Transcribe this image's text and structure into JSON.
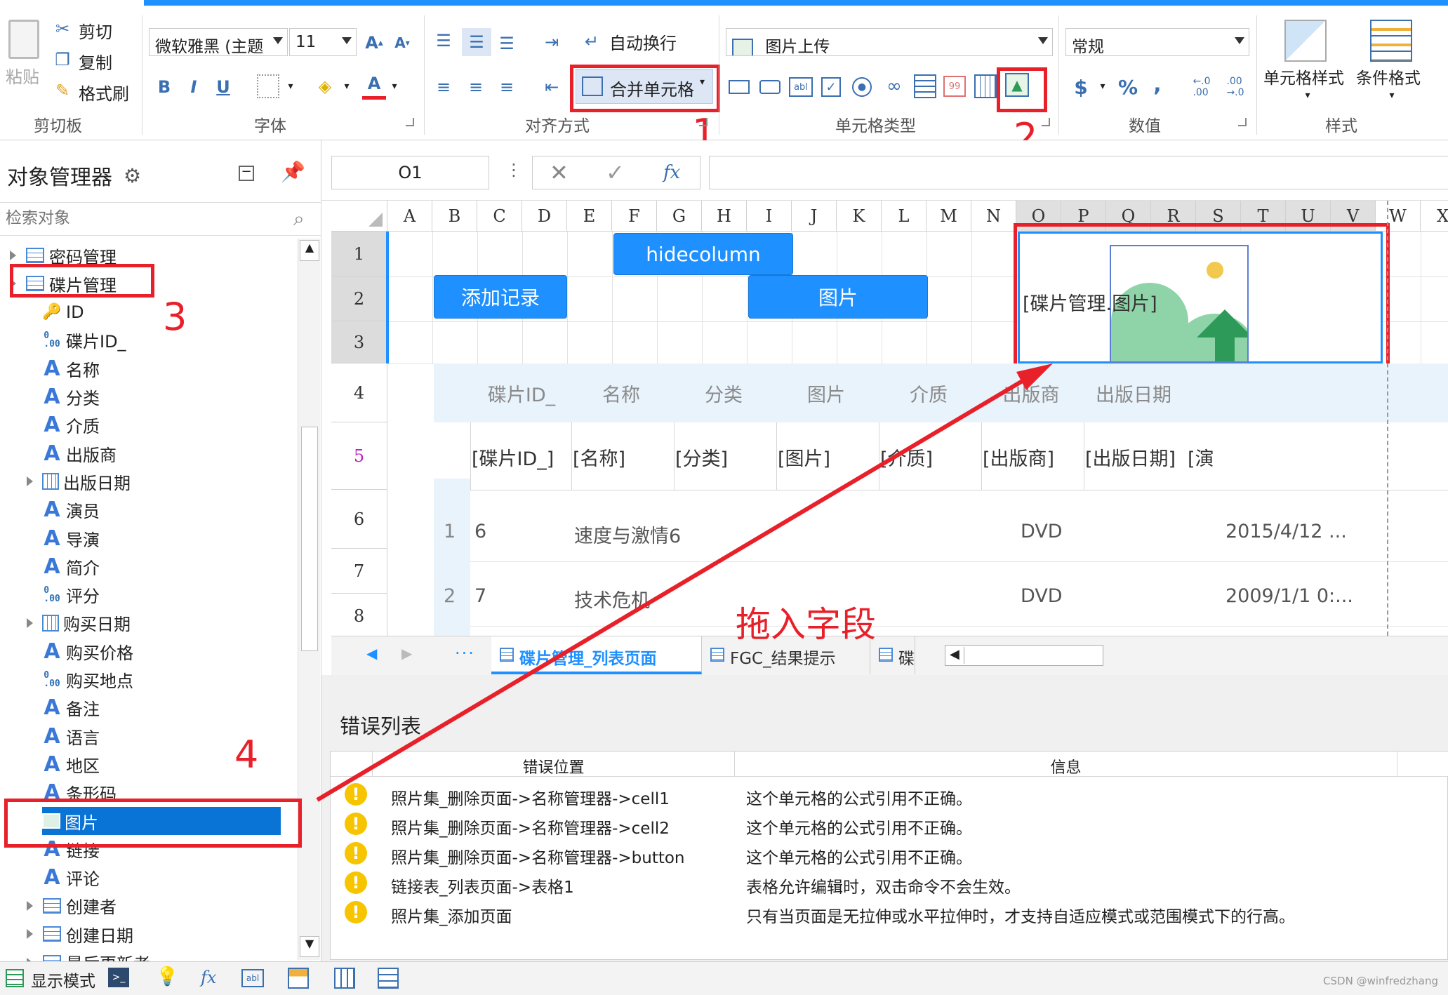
{
  "ribbon": {
    "clipboard": {
      "paste_label": "粘贴",
      "cut_label": "剪切",
      "copy_label": "复制",
      "format_painter_label": "格式刷",
      "group_label": "剪切板"
    },
    "font": {
      "font_name": "微软雅黑 (主题",
      "font_size": "11",
      "bold": "B",
      "italic": "I",
      "underline": "U",
      "group_label": "字体"
    },
    "alignment": {
      "wrap_text_label": "自动换行",
      "merge_cells_label": "合并单元格",
      "group_label": "对齐方式"
    },
    "cell_type": {
      "selected_type": "图片上传",
      "group_label": "单元格类型"
    },
    "number": {
      "format": "常规",
      "currency": "$",
      "percent": "%",
      "comma": ",",
      "group_label": "数值"
    },
    "styles": {
      "cell_style_label": "单元格样式",
      "conditional_format_label": "条件格式",
      "group_label": "样式"
    }
  },
  "object_manager": {
    "title": "对象管理器",
    "search_placeholder": "检索对象",
    "items": [
      {
        "label": "密码管理",
        "type": "table",
        "indent": 0,
        "expandable": true
      },
      {
        "label": "碟片管理",
        "type": "table",
        "indent": 0,
        "expandable": true
      },
      {
        "label": "ID",
        "type": "key",
        "indent": 1
      },
      {
        "label": "碟片ID_",
        "type": "number",
        "indent": 1
      },
      {
        "label": "名称",
        "type": "text",
        "indent": 1
      },
      {
        "label": "分类",
        "type": "text",
        "indent": 1
      },
      {
        "label": "介质",
        "type": "text",
        "indent": 1
      },
      {
        "label": "出版商",
        "type": "text",
        "indent": 1
      },
      {
        "label": "出版日期",
        "type": "date",
        "indent": 1,
        "expandable": true
      },
      {
        "label": "演员",
        "type": "text",
        "indent": 1
      },
      {
        "label": "导演",
        "type": "text",
        "indent": 1
      },
      {
        "label": "简介",
        "type": "text",
        "indent": 1
      },
      {
        "label": "评分",
        "type": "number",
        "indent": 1
      },
      {
        "label": "购买日期",
        "type": "date",
        "indent": 1,
        "expandable": true
      },
      {
        "label": "购买价格",
        "type": "text",
        "indent": 1
      },
      {
        "label": "购买地点",
        "type": "number",
        "indent": 1
      },
      {
        "label": "备注",
        "type": "text",
        "indent": 1
      },
      {
        "label": "语言",
        "type": "text",
        "indent": 1
      },
      {
        "label": "地区",
        "type": "text",
        "indent": 1
      },
      {
        "label": "条形码",
        "type": "text",
        "indent": 1
      },
      {
        "label": "图片",
        "type": "image",
        "indent": 1,
        "selected": true
      },
      {
        "label": "链接",
        "type": "text",
        "indent": 1
      },
      {
        "label": "评论",
        "type": "text",
        "indent": 1
      },
      {
        "label": "创建者",
        "type": "table",
        "indent": 1,
        "expandable": true
      },
      {
        "label": "创建日期",
        "type": "table",
        "indent": 1,
        "expandable": true
      },
      {
        "label": "最后更新者",
        "type": "table",
        "indent": 1,
        "expandable": true
      }
    ]
  },
  "formula_bar": {
    "cell_ref": "O1",
    "fx_label": "fx"
  },
  "grid": {
    "columns": [
      "A",
      "B",
      "C",
      "D",
      "E",
      "F",
      "G",
      "H",
      "I",
      "J",
      "K",
      "L",
      "M",
      "N",
      "O",
      "P",
      "Q",
      "R",
      "S",
      "T",
      "U",
      "V",
      "W",
      "X"
    ],
    "rows": [
      "1",
      "2",
      "3",
      "4",
      "5",
      "6",
      "7",
      "8"
    ],
    "buttons": {
      "hidecolumn": "hidecolumn",
      "add_record": "添加记录",
      "image": "图片"
    },
    "image_cell_text": "[碟片管理.图片]",
    "list_headers": [
      "碟片ID_",
      "名称",
      "分类",
      "图片",
      "介质",
      "出版商",
      "出版日期"
    ],
    "template_row": [
      "[碟片ID_]",
      "[名称]",
      "[分类]",
      "[图片]",
      "[介质]",
      "[出版商]",
      "[出版日期]",
      "[演"
    ],
    "data_rows": [
      {
        "idx": "1",
        "id": "6",
        "name": "速度与激情6",
        "media": "DVD",
        "date": "2015/4/12 ..."
      },
      {
        "idx": "2",
        "id": "7",
        "name": "技术危机",
        "media": "DVD",
        "date": "2009/1/1 0:..."
      }
    ]
  },
  "sheet_tabs": {
    "more": "···",
    "tabs": [
      {
        "label": "碟片管理_列表页面",
        "active": true
      },
      {
        "label": "FGC_结果提示",
        "active": false
      },
      {
        "label": "碟",
        "active": false
      }
    ]
  },
  "errors": {
    "title": "错误列表",
    "col_position": "错误位置",
    "col_info": "信息",
    "rows": [
      {
        "position": "照片集_删除页面->名称管理器->cell1",
        "info": "这个单元格的公式引用不正确。"
      },
      {
        "position": "照片集_删除页面->名称管理器->cell2",
        "info": "这个单元格的公式引用不正确。"
      },
      {
        "position": "照片集_删除页面->名称管理器->button",
        "info": "这个单元格的公式引用不正确。"
      },
      {
        "position": "链接表_列表页面->表格1",
        "info": "表格允许编辑时，双击命令不会生效。"
      },
      {
        "position": "照片集_添加页面",
        "info": "只有当页面是无拉伸或水平拉伸时，才支持自适应模式或范围模式下的行高。"
      }
    ]
  },
  "status": {
    "display_mode": "显示模式",
    "credit": "CSDN @winfredzhang"
  },
  "annotations": {
    "n1": "1",
    "n2": "2",
    "n3": "3",
    "n4": "4",
    "drag_label": "拖入字段"
  },
  "colors": {
    "accent": "#1e90ff",
    "annotation": "#e8202a",
    "selection": "#0a74d6",
    "list_header_bg": "#e9f3fc"
  }
}
